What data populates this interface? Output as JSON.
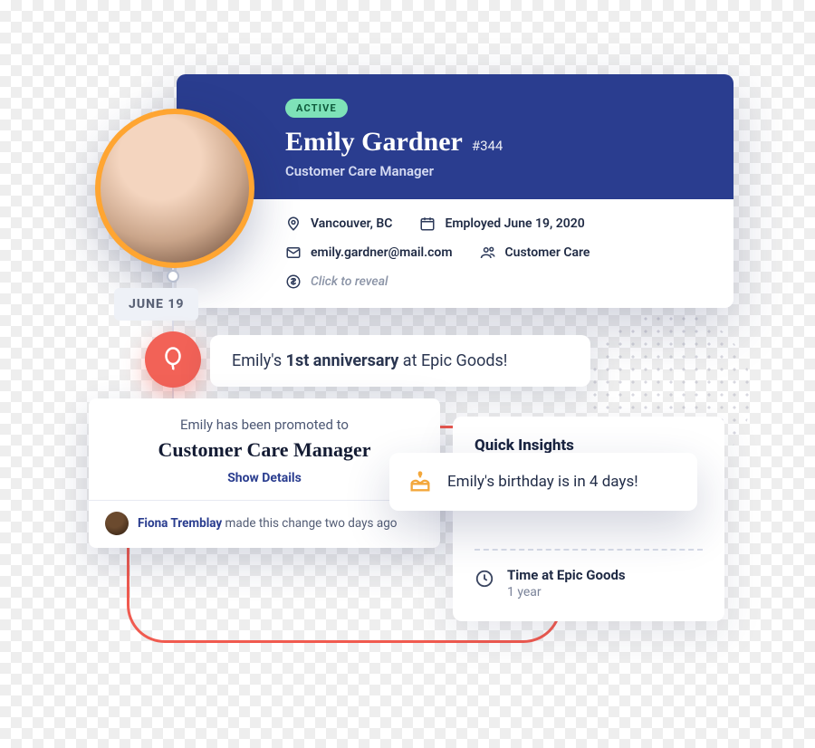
{
  "profile": {
    "status_badge": "ACTIVE",
    "name": "Emily Gardner",
    "id_label": "#344",
    "role": "Customer Care Manager",
    "location": "Vancouver, BC",
    "employed_label": "Employed June 19, 2020",
    "email": "emily.gardner@mail.com",
    "team": "Customer Care",
    "salary_reveal": "Click to reveal"
  },
  "timeline": {
    "date_label": "JUNE 19",
    "anniversary_prefix": "Emily's ",
    "anniversary_bold": "1st anniversary",
    "anniversary_suffix": " at Epic Goods!"
  },
  "promotion": {
    "intro": "Emily has been promoted to",
    "title": "Customer Care Manager",
    "details_link": "Show Details",
    "author": "Fiona Tremblay",
    "footer_suffix": " made this change two days ago"
  },
  "insights": {
    "title": "Quick Insights",
    "birthday_text": "Emily's birthday is in 4 days!",
    "tenure_label": "Time at Epic Goods",
    "tenure_value": "1 year"
  }
}
